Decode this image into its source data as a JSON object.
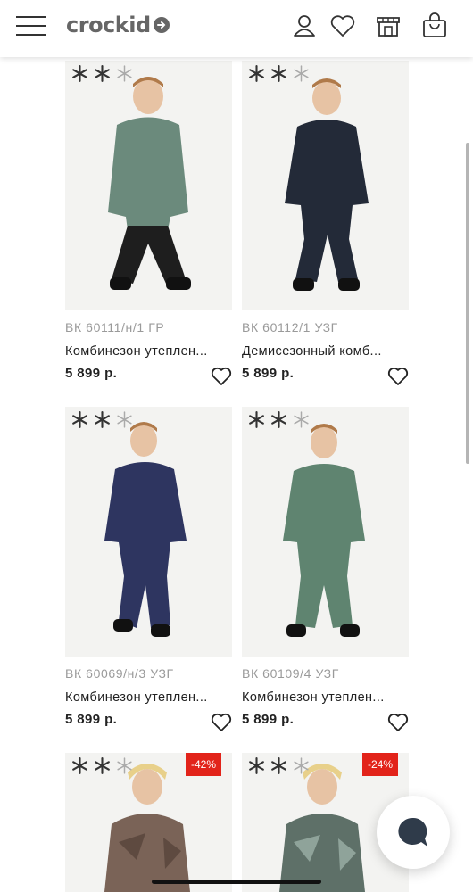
{
  "header": {
    "logo_text": "crockid",
    "icons": [
      "menu-icon",
      "user-icon",
      "heart-icon",
      "store-icon",
      "bag-icon"
    ]
  },
  "products": [
    {
      "sku": "ВК 60111/н/1 ГР",
      "name": "Комбинезон утеплен...",
      "price": "5 899 р.",
      "color": "#6b8a7c",
      "discount": ""
    },
    {
      "sku": "ВК 60112/1 УЗГ",
      "name": "Демисезонный комб...",
      "price": "5 899 р.",
      "color": "#232a38",
      "discount": ""
    },
    {
      "sku": "ВК 60069/н/3 УЗГ",
      "name": "Комбинезон утеплен...",
      "price": "5 899 р.",
      "color": "#2e3560",
      "discount": ""
    },
    {
      "sku": "ВК 60109/4 УЗГ",
      "name": "Комбинезон утеплен...",
      "price": "5 899 р.",
      "color": "#5f8470",
      "discount": ""
    },
    {
      "sku": "",
      "name": "",
      "price": "",
      "color": "#7a6357",
      "discount": "-42%"
    },
    {
      "sku": "",
      "name": "",
      "price": "",
      "color": "#5e7068",
      "discount": "-24%"
    }
  ],
  "colors": {
    "discount": "#e2231a",
    "logo": "#666666",
    "chat_icon": "#2f3b4a"
  }
}
